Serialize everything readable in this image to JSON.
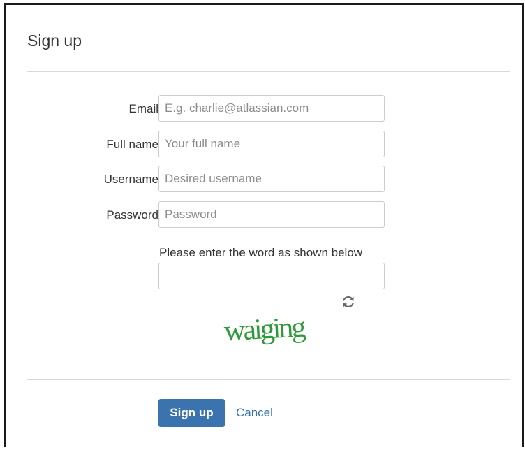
{
  "dialog": {
    "title": "Sign up"
  },
  "form": {
    "required_marker": "*",
    "fields": [
      {
        "label": "Email",
        "placeholder": "E.g. charlie@atlassian.com",
        "value": ""
      },
      {
        "label": "Full name",
        "placeholder": "Your full name",
        "value": ""
      },
      {
        "label": "Username",
        "placeholder": "Desired username",
        "value": ""
      },
      {
        "label": "Password",
        "placeholder": "Password",
        "value": ""
      }
    ],
    "captcha": {
      "prompt": "Please enter the word as shown below",
      "value": "",
      "image_word": "waiging",
      "refresh_icon": "refresh-icon"
    }
  },
  "actions": {
    "submit_label": "Sign up",
    "cancel_label": "Cancel"
  },
  "colors": {
    "primary_button": "#3b73af",
    "link": "#3572b0",
    "required": "#d04437",
    "captcha_text": "#2e9a3a"
  }
}
